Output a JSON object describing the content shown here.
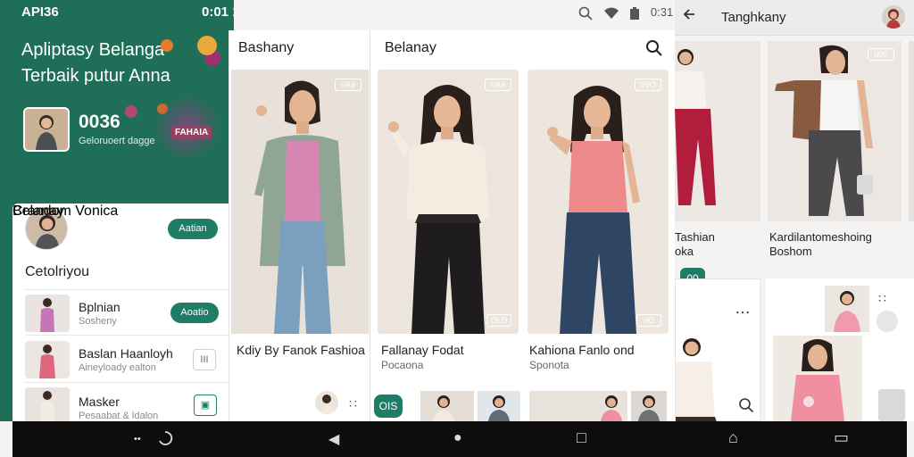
{
  "status_bar": {
    "left": "API36",
    "right": "0:01 1 2"
  },
  "sys_icons": {
    "search": "search-icon",
    "wifi": "wifi-icon",
    "battery": "battery-icon",
    "time": "0:31"
  },
  "panel1": {
    "hero_title": "Apliptasy Belanga Terbaik putur Anna",
    "count": "0036",
    "count_sub": "Geloruoert dagge",
    "tag": "FAHAIA",
    "profile": {
      "name": "Belanay",
      "sub": "Crandom Vonica",
      "button": "Aatian"
    },
    "section_title": "Cetolriyou",
    "rows": [
      {
        "title": "Bplnian",
        "sub": "Sosheny",
        "action": "Aoatio"
      },
      {
        "title": "Baslan Haanloyh",
        "sub": "Aineyloady ealton",
        "action": "III"
      },
      {
        "title": "Masker",
        "sub": "Pesaabat & ldalon",
        "action": "▣"
      }
    ]
  },
  "panel2": {
    "title": "Bashany",
    "caption": "Kdiy By Fanok Fashioa"
  },
  "panel3": {
    "title": "Belanay",
    "badges": [
      "0A4",
      "0VO"
    ],
    "cards": [
      {
        "title": "Fallanay Fodat",
        "sub": "Pocaona",
        "badge_bottom": "OLD"
      },
      {
        "title": "Kahiona Fanlo ond",
        "sub": "Sponota",
        "badge_bottom": "0O"
      }
    ],
    "bottom_chip": "OIS"
  },
  "panel4": {
    "title": "Tanghkany",
    "tile_badge": "000",
    "captions": [
      {
        "title": "Tashian",
        "sub": "oka"
      },
      {
        "title": "Kardilantomeshoing",
        "sub": "Boshom"
      }
    ],
    "chip": "00",
    "more": "…",
    "grid_icon": "∷"
  },
  "navbar": {
    "items": [
      "••",
      "◀",
      "●",
      "□",
      "⌂",
      "▭"
    ]
  }
}
